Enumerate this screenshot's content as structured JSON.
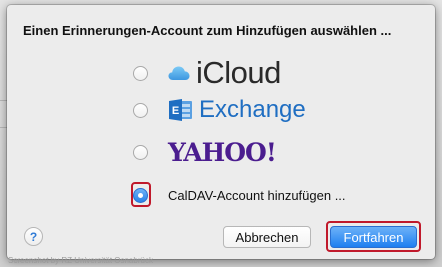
{
  "dialog": {
    "title": "Einen Erinnerungen-Account zum Hinzufügen auswählen ...",
    "options": [
      {
        "id": "icloud",
        "label": "iCloud",
        "selected": false
      },
      {
        "id": "exchange",
        "label": "Exchange",
        "selected": false
      },
      {
        "id": "yahoo",
        "label": "YAHOO!",
        "selected": false
      },
      {
        "id": "caldav",
        "label": "CalDAV-Account hinzufügen ...",
        "selected": true
      }
    ],
    "help_label": "?",
    "cancel_label": "Abbrechen",
    "continue_label": "Fortfahren"
  },
  "watermark": "Screenshot by RZ Universität Osnabrück",
  "colors": {
    "highlight": "#c0192b",
    "accent": "#1f7ff0",
    "exchange_blue": "#1f6ec2",
    "yahoo_purple": "#4b1d8f",
    "icloud_blue": "#5fb2ee"
  },
  "icons": {
    "icloud": "icloud-cloud-icon",
    "exchange": "exchange-logo-icon",
    "help": "help-icon"
  }
}
